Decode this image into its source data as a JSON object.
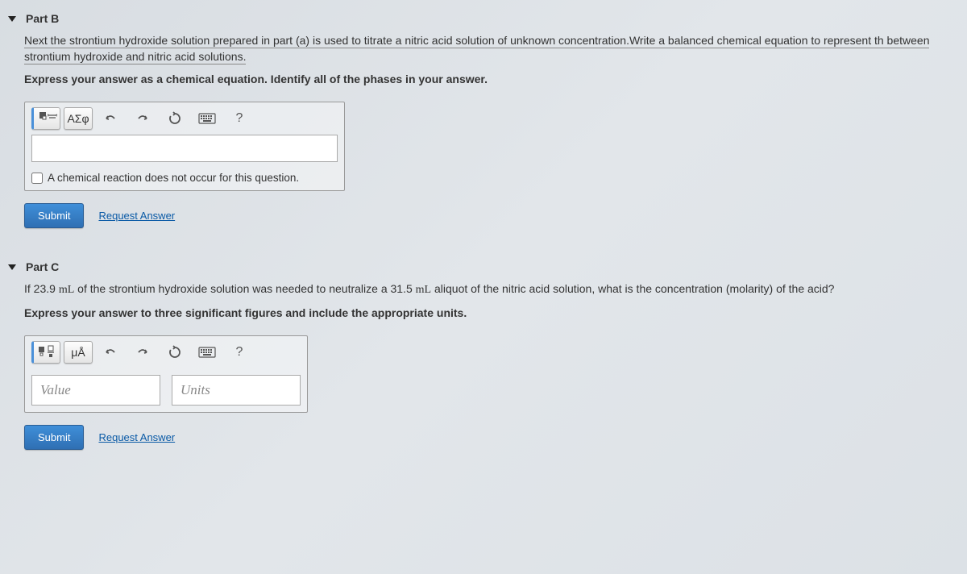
{
  "partB": {
    "title": "Part B",
    "question": "Next the strontium hydroxide solution prepared in part (a) is used to titrate a nitric acid solution of unknown concentration.Write a balanced chemical equation to represent th between strontium hydroxide and nitric acid solutions.",
    "instruction": "Express your answer as a chemical equation. Identify all of the phases in your answer.",
    "toolbar": {
      "symbols_label": "ΑΣφ",
      "help_label": "?"
    },
    "no_reaction_label": "A chemical reaction does not occur for this question.",
    "submit_label": "Submit",
    "request_label": "Request Answer"
  },
  "partC": {
    "title": "Part C",
    "question_prefix": "If 23.9 ",
    "question_unit1": "mL",
    "question_mid": " of the strontium hydroxide solution was needed to neutralize a 31.5 ",
    "question_unit2": "mL",
    "question_suffix": " aliquot of the nitric acid solution, what is the concentration (molarity) of the acid?",
    "instruction": "Express your answer to three significant figures and include the appropriate units.",
    "toolbar": {
      "units_label": "μÅ",
      "help_label": "?"
    },
    "value_placeholder": "Value",
    "units_placeholder": "Units",
    "submit_label": "Submit",
    "request_label": "Request Answer"
  }
}
